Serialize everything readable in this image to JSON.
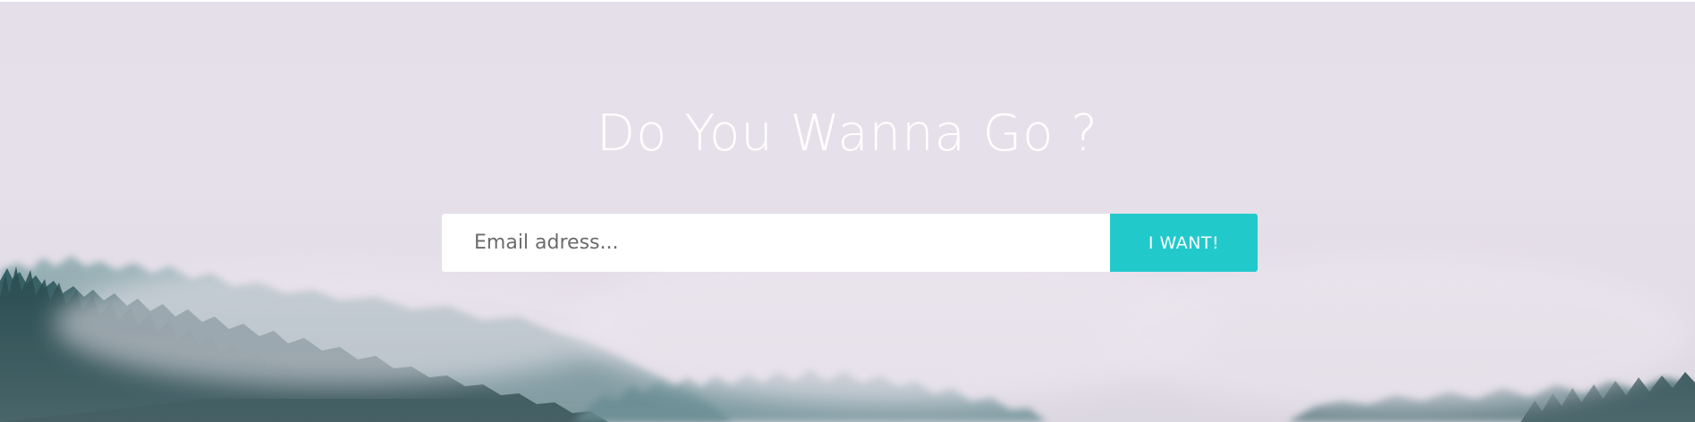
{
  "hero": {
    "headline": "Do You Wanna Go ?",
    "background": "misty-forest-photo"
  },
  "signup": {
    "email_placeholder": "Email adress...",
    "email_value": "",
    "submit_label": "I WANT!",
    "accent_color": "#22c9cb"
  }
}
